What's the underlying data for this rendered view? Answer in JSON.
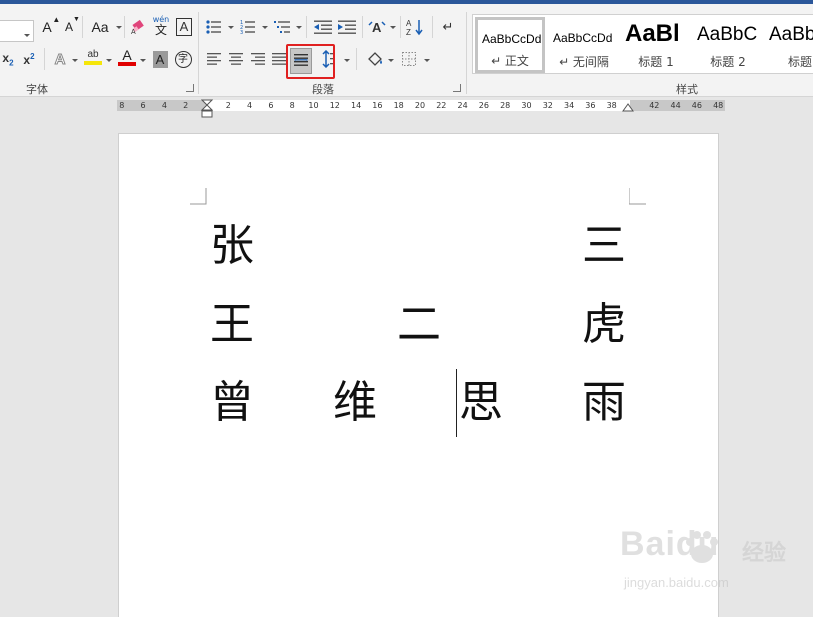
{
  "ribbon": {
    "groups": {
      "font": "字体",
      "paragraph": "段落",
      "styles": "样式"
    },
    "font_buttons": {
      "grow_font": "A",
      "shrink_font": "A",
      "change_case": "Aa",
      "phonetic_top": "wén",
      "phonetic_bottom": "文",
      "char_border": "A",
      "subscript": "x",
      "subscript_mark": "2",
      "superscript": "x",
      "superscript_mark": "2",
      "text_effects": "A",
      "highlight": "ab",
      "font_color": "A",
      "char_shading": "A",
      "enclose_char": "字"
    },
    "styles_gallery": [
      {
        "sample": "AaBbCcDd",
        "name": "↵ 正文",
        "selected": true
      },
      {
        "sample": "AaBbCcDd",
        "name": "↵ 无间隔",
        "selected": false
      },
      {
        "sample": "AaBl",
        "name": "标题 1",
        "selected": false
      },
      {
        "sample": "AaBbC",
        "name": "标题 2",
        "selected": false
      },
      {
        "sample": "AaBb",
        "name": "标题",
        "selected": false
      }
    ],
    "highlight_color": "#f5e60a",
    "font_color_bar": "#e00000",
    "callout_color": "#e02020"
  },
  "ruler": {
    "left_ticks": [
      "8",
      "6",
      "4",
      "2"
    ],
    "right_ticks": [
      "2",
      "4",
      "6",
      "8",
      "10",
      "12",
      "14",
      "16",
      "18",
      "20",
      "22",
      "24",
      "26",
      "28",
      "30",
      "32",
      "34",
      "36",
      "38"
    ],
    "margin_ticks": [
      "42",
      "44",
      "46",
      "48"
    ]
  },
  "document": {
    "rows": [
      [
        "张",
        "",
        "",
        "三"
      ],
      [
        "王",
        "",
        "二",
        "虎"
      ],
      [
        "曾",
        "维",
        "思",
        "雨"
      ]
    ]
  },
  "watermark": {
    "brand": "Baidu",
    "cn": "经验",
    "url": "jingyan.baidu.com"
  }
}
